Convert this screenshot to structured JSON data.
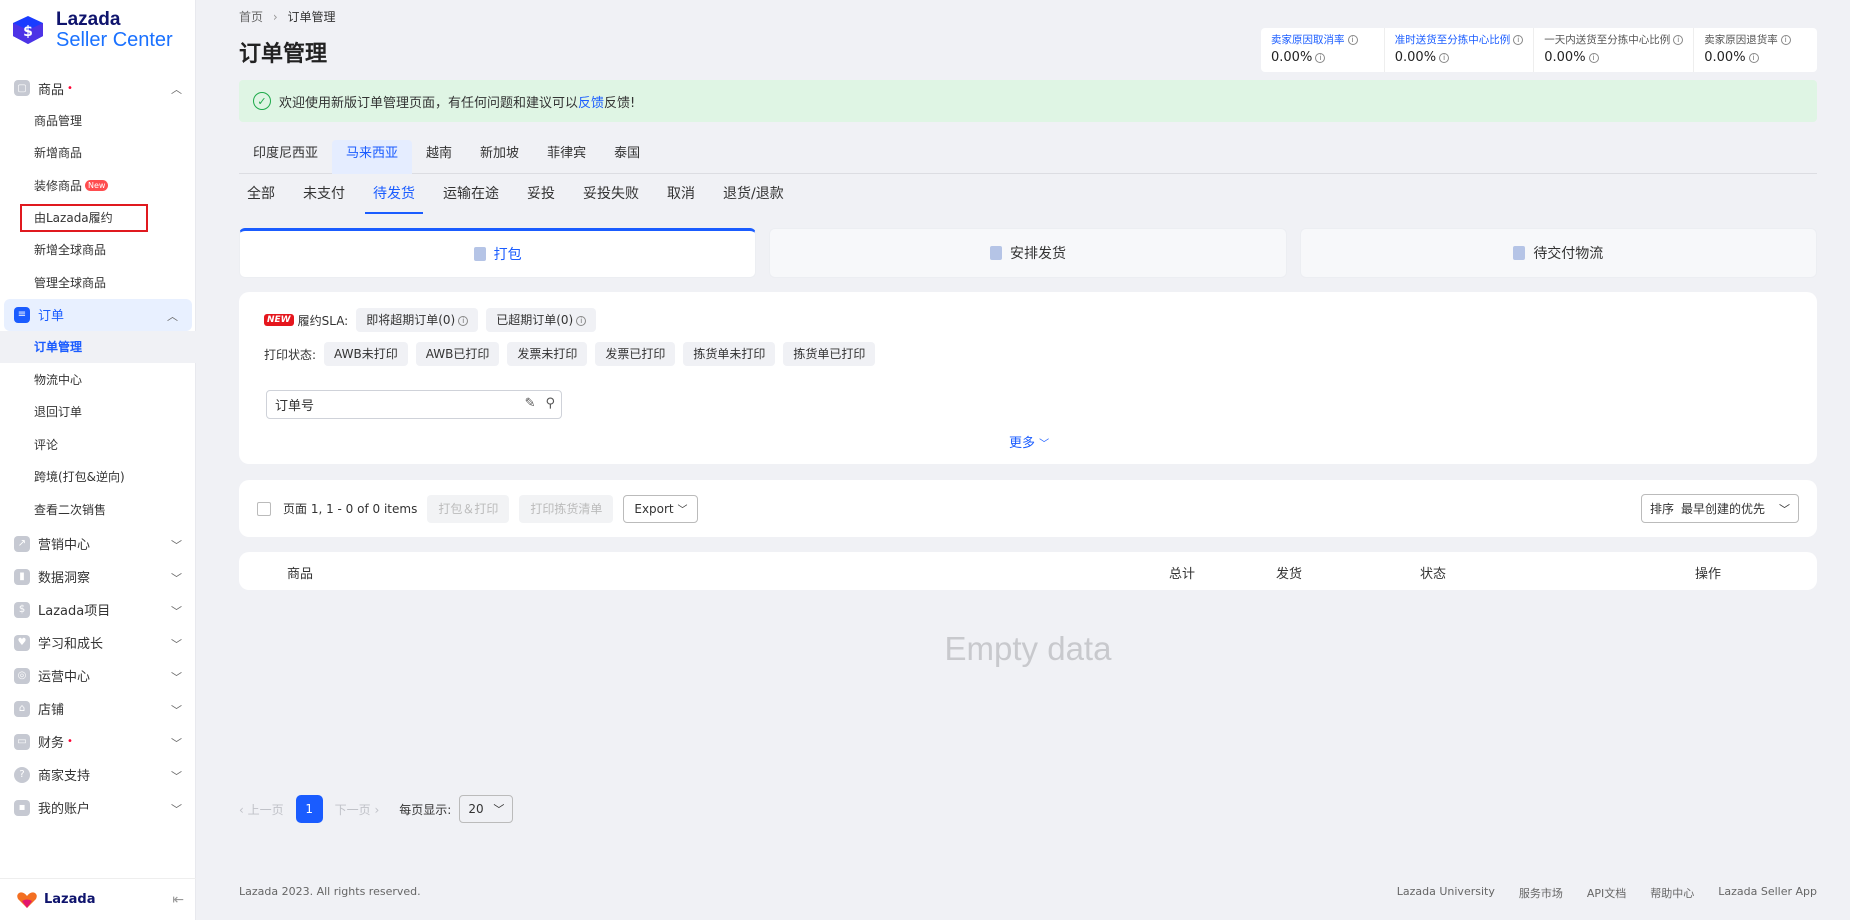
{
  "brand": {
    "line1": "Lazada",
    "line2": "Seller Center",
    "footer_name": "Lazada"
  },
  "sidebar": {
    "groups": [
      {
        "label": "商品",
        "dot": "•"
      },
      {
        "label": "订单"
      },
      {
        "label": "营销中心"
      },
      {
        "label": "数据洞察"
      },
      {
        "label": "Lazada项目"
      },
      {
        "label": "学习和成长"
      },
      {
        "label": "运营中心"
      },
      {
        "label": "店铺"
      },
      {
        "label": "财务",
        "dot": "•"
      },
      {
        "label": "商家支持"
      },
      {
        "label": "我的账户"
      }
    ],
    "product_items": [
      "商品管理",
      "新增商品",
      "装修商品",
      "由Lazada履约",
      "新增全球商品",
      "管理全球商品"
    ],
    "new_badge": "New",
    "order_items": [
      "订单管理",
      "物流中心",
      "退回订单",
      "评论",
      "跨境(打包&逆向)",
      "查看二次销售"
    ]
  },
  "breadcrumb": {
    "home": "首页",
    "sep": "›",
    "current": "订单管理"
  },
  "page_title": "订单管理",
  "stats": [
    {
      "label": "卖家原因取消率",
      "value": "0.00%"
    },
    {
      "label": "准时送货至分拣中心比例",
      "value": "0.00%"
    },
    {
      "label": "一天内送货至分拣中心比例",
      "value": "0.00%"
    },
    {
      "label": "卖家原因退货率",
      "value": "0.00%"
    }
  ],
  "notice": {
    "text": "欢迎使用新版订单管理页面，有任何问题和建议可以",
    "link": "反馈",
    "suffix": " 反馈!"
  },
  "country_tabs": [
    "印度尼西亚",
    "马来西亚",
    "越南",
    "新加坡",
    "菲律宾",
    "泰国"
  ],
  "status_tabs": [
    "全部",
    "未支付",
    "待发货",
    "运输在途",
    "妥投",
    "妥投失败",
    "取消",
    "退货/退款"
  ],
  "step_cards": [
    "打包",
    "安排发货",
    "待交付物流"
  ],
  "filter": {
    "new_badge": "NEW",
    "sla_label": "履约SLA:",
    "sla_chips": [
      "即将超期订单(0)",
      "已超期订单(0)"
    ],
    "print_label": "打印状态:",
    "print_chips": [
      "AWB未打印",
      "AWB已打印",
      "发票未打印",
      "发票已打印",
      "拣货单未打印",
      "拣货单已打印"
    ],
    "search_placeholder": "订单号",
    "more": "更多"
  },
  "action_bar": {
    "page_info": "页面 1, 1 - 0 of 0 items",
    "pack_print": "打包＆打印",
    "print_pick": "打印拣货清单",
    "export": "Export",
    "sort_label": "排序",
    "sort_value": "最早创建的优先"
  },
  "table": {
    "headers": [
      "商品",
      "总计",
      "发货",
      "状态",
      "操作"
    ],
    "empty": "Empty data"
  },
  "pager": {
    "prev": "上一页",
    "current": "1",
    "next": "下一页",
    "per_page_label": "每页显示:",
    "per_page": "20"
  },
  "footer": {
    "copyright": "Lazada 2023. All rights reserved.",
    "links": [
      "Lazada University",
      "服务市场",
      "API文档",
      "帮助中心",
      "Lazada Seller App"
    ]
  },
  "colors": {
    "accent": "#1a5cff",
    "notice_bg": "#dff5e4",
    "highlight_box": "#e0191f",
    "new_badge": "#e5161d"
  }
}
